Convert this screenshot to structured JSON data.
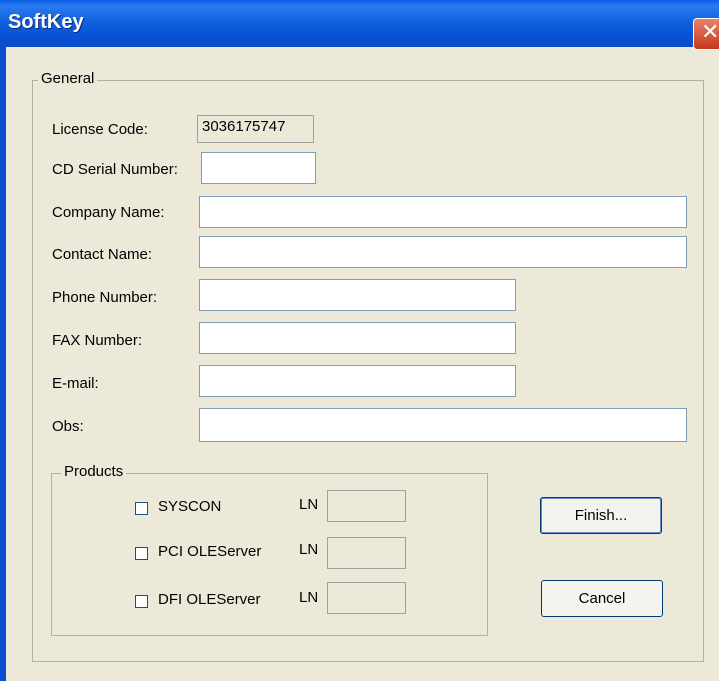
{
  "window": {
    "title": "SoftKey",
    "close_glyph": "✕"
  },
  "general": {
    "title": "General",
    "license_code_label": "License Code:",
    "license_code_value": "3036175747",
    "cd_serial_label": "CD Serial Number:",
    "company_label": "Company Name:",
    "contact_label": "Contact Name:",
    "phone_label": "Phone Number:",
    "fax_label": "FAX Number:",
    "email_label": "E-mail:",
    "obs_label": "Obs:"
  },
  "products": {
    "title": "Products",
    "ln_label": "LN",
    "items": [
      {
        "label": "SYSCON",
        "checked": false
      },
      {
        "label": "PCI OLEServer",
        "checked": false
      },
      {
        "label": "DFI OLEServer",
        "checked": false
      }
    ]
  },
  "buttons": {
    "finish": "Finish...",
    "cancel": "Cancel"
  }
}
